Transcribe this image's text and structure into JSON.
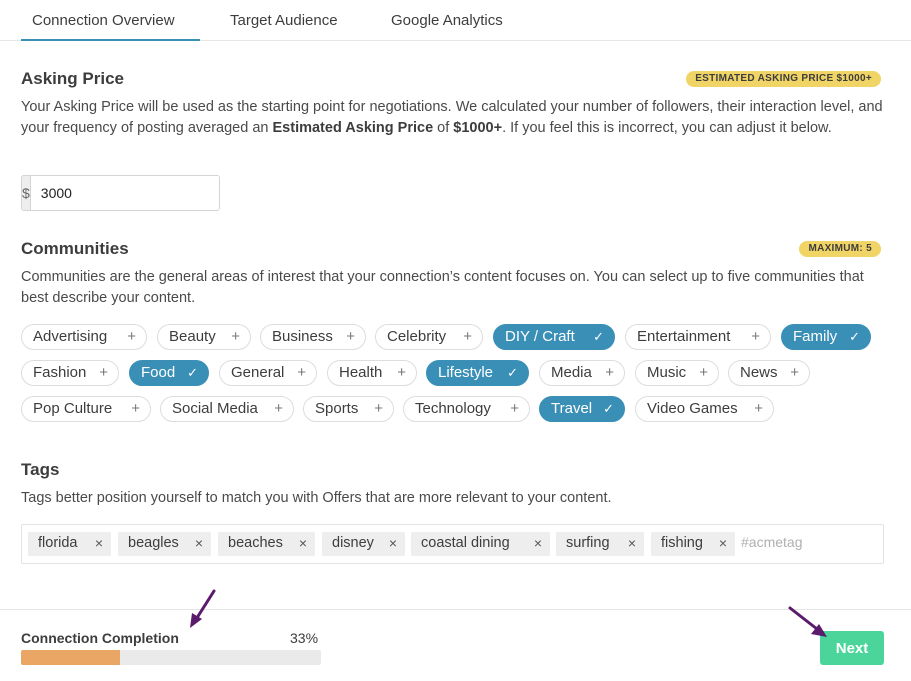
{
  "tabs": [
    {
      "label": "Connection Overview",
      "active": true
    },
    {
      "label": "Target Audience",
      "active": false
    },
    {
      "label": "Google Analytics",
      "active": false
    }
  ],
  "asking_price": {
    "title": "Asking Price",
    "badge": "ESTIMATED ASKING PRICE $1000+",
    "desc_part1": "Your Asking Price will be used as the starting point for negotiations. We calculated your number of followers, their interaction level, and your frequency of posting averaged an ",
    "desc_bold1": "Estimated Asking Price",
    "desc_part2": " of ",
    "desc_bold2": "$1000+",
    "desc_part3": ". If you feel this is incorrect, you can adjust it below.",
    "currency_symbol": "$",
    "value": "3000"
  },
  "communities": {
    "title": "Communities",
    "badge": "MAXIMUM: 5",
    "desc": "Communities are the general areas of interest that your connection’s content focuses on. You can select up to five communities that best describe your content.",
    "items": [
      {
        "label": "Advertising",
        "selected": false
      },
      {
        "label": "Beauty",
        "selected": false
      },
      {
        "label": "Business",
        "selected": false
      },
      {
        "label": "Celebrity",
        "selected": false
      },
      {
        "label": "DIY / Craft",
        "selected": true
      },
      {
        "label": "Entertainment",
        "selected": false
      },
      {
        "label": "Family",
        "selected": true
      },
      {
        "label": "Fashion",
        "selected": false
      },
      {
        "label": "Food",
        "selected": true
      },
      {
        "label": "General",
        "selected": false
      },
      {
        "label": "Health",
        "selected": false
      },
      {
        "label": "Lifestyle",
        "selected": true
      },
      {
        "label": "Media",
        "selected": false
      },
      {
        "label": "Music",
        "selected": false
      },
      {
        "label": "News",
        "selected": false
      },
      {
        "label": "Pop Culture",
        "selected": false
      },
      {
        "label": "Social Media",
        "selected": false
      },
      {
        "label": "Sports",
        "selected": false
      },
      {
        "label": "Technology",
        "selected": false
      },
      {
        "label": "Travel",
        "selected": true
      },
      {
        "label": "Video Games",
        "selected": false
      }
    ],
    "add_glyph": "+",
    "check_glyph": "✓"
  },
  "tags": {
    "title": "Tags",
    "desc": "Tags better position yourself to match you with Offers that are more relevant to your content.",
    "items": [
      "florida",
      "beagles",
      "beaches",
      "disney",
      "coastal dining",
      "surfing",
      "fishing"
    ],
    "remove_glyph": "×",
    "input_placeholder": "#acmetag",
    "input_value": ""
  },
  "footer": {
    "completion_label": "Connection Completion",
    "completion_percent_text": "33%",
    "completion_value": 0.33,
    "next_label": "Next"
  },
  "colors": {
    "accent": "#3a8fb7",
    "badge": "#f1d466",
    "progress_fill": "#e9a664",
    "next_button": "#4bd59a",
    "annotation_arrow": "#5b1a6b"
  }
}
